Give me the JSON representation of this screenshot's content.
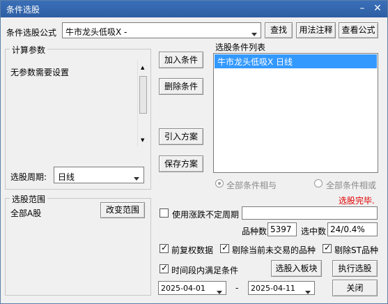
{
  "window": {
    "title": "条件选股",
    "minimize": "–",
    "close": "✕"
  },
  "formula": {
    "label": "条件选股公式",
    "value": "牛市龙头低吸X -"
  },
  "buttons": {
    "find": "查找",
    "usage": "用法注释",
    "view_formula": "查看公式",
    "add_condition": "加入条件",
    "delete_condition": "删除条件",
    "import_plan": "引入方案",
    "save_plan": "保存方案",
    "change_range": "改变范围",
    "add_to_block": "选股入板块",
    "execute": "执行选股",
    "close": "关闭"
  },
  "params": {
    "group_title": "计算参数",
    "text": "无参数需要设置"
  },
  "period": {
    "label": "选股周期:",
    "value": "日线"
  },
  "range": {
    "group_title": "选股范围",
    "value": "全部A股"
  },
  "condition_list": {
    "label": "选股条件列表",
    "items": [
      "牛市龙头低吸X  日线"
    ]
  },
  "logic": {
    "all_and": "全部条件相与",
    "all_or": "全部条件相或",
    "selected": "all_and"
  },
  "status": {
    "text": "选股完毕.",
    "color": "#e00000"
  },
  "uncertain_period": {
    "label": "使用涨跌不定周期",
    "checked": false,
    "value": ""
  },
  "stats": {
    "count_label": "品种数",
    "count_value": "5397",
    "selected_label": "选中数",
    "selected_value": "24/0.4%"
  },
  "options": {
    "pre_adjust": {
      "label": "前复权数据",
      "checked": true
    },
    "exclude_untraded": {
      "label": "剔除当前未交易的品种",
      "checked": true
    },
    "exclude_st": {
      "label": "剔除ST品种",
      "checked": true
    },
    "time_range": {
      "label": "时间段内满足条件",
      "checked": true
    }
  },
  "dates": {
    "start": "2025-04-01",
    "separator": "-",
    "end": "2025-04-11"
  }
}
